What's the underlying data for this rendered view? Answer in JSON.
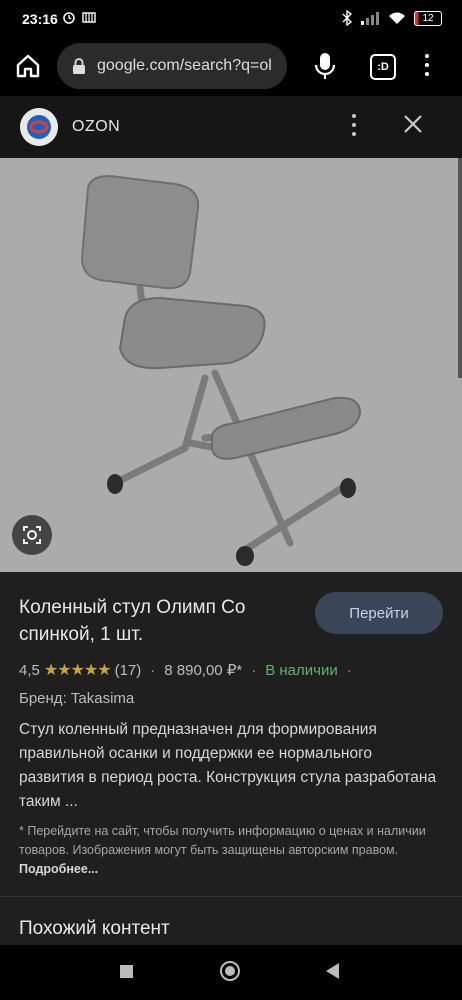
{
  "status_bar": {
    "time": "23:16",
    "battery_level": "12"
  },
  "browser": {
    "url": "google.com/search?q=ol",
    "tabs_label": ":D"
  },
  "site": {
    "name": "OZON"
  },
  "product": {
    "title": "Коленный стул Олимп Со спинкой, 1 шт.",
    "go_button_label": "Перейти",
    "rating": "4,5",
    "stars": "★★★★★",
    "reviews": "(17)",
    "price": "8 890,00 ₽*",
    "availability": "В наличии",
    "brand": "Бренд: Takasima",
    "description": "Стул коленный предназначен для формирования правильной осанки и поддержки ее нормального развития в период роста. Конструкция стула разработана таким ...",
    "disclaimer": "* Перейдите на сайт, чтобы получить информацию о ценах и наличии товаров. Изображения могут быть защищены авторским правом.",
    "more_link": "Подробнее..."
  },
  "similar": {
    "heading": "Похожий контент"
  },
  "colors": {
    "background": "#1f1f1f",
    "button": "#3b4558",
    "in_stock": "#5fb36d",
    "stars": "#c8a23a"
  }
}
